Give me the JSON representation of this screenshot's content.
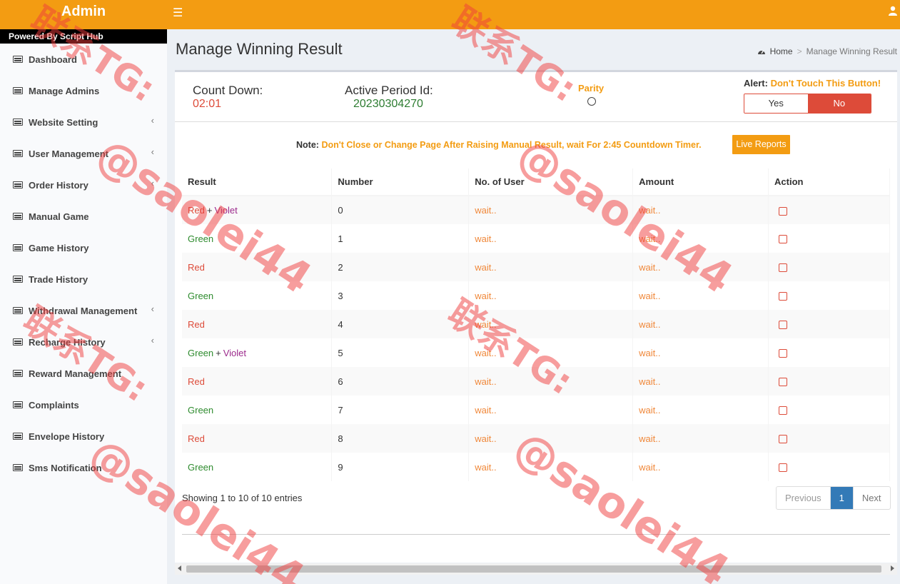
{
  "header": {
    "brand": "Admin",
    "powered_by": "Powered By Script Hub"
  },
  "sidebar": {
    "items": [
      {
        "label": "Dashboard",
        "chevron": ""
      },
      {
        "label": "Manage Admins",
        "chevron": ""
      },
      {
        "label": "Website Setting",
        "chevron": "‹"
      },
      {
        "label": "User Management",
        "chevron": "‹"
      },
      {
        "label": "Order History",
        "chevron": "‹"
      },
      {
        "label": "Manual Game",
        "chevron": ""
      },
      {
        "label": "Game History",
        "chevron": ""
      },
      {
        "label": "Trade History",
        "chevron": ""
      },
      {
        "label": "Withdrawal Management",
        "chevron": "‹"
      },
      {
        "label": "Recharge History",
        "chevron": "‹"
      },
      {
        "label": "Reward Management",
        "chevron": ""
      },
      {
        "label": "Complaints",
        "chevron": ""
      },
      {
        "label": "Envelope History",
        "chevron": ""
      },
      {
        "label": "Sms Notification",
        "chevron": ""
      }
    ]
  },
  "page": {
    "title": "Manage Winning Result",
    "breadcrumb": {
      "home": "Home",
      "sep": ">",
      "current": "Manage Winning Result"
    }
  },
  "info": {
    "countdown_label": "Count Down:",
    "countdown_value": "02:01",
    "period_label": "Active Period Id:",
    "period_value": "20230304270",
    "parity_label": "Parity",
    "alert_key": "Alert:",
    "alert_value": "Don't Touch This Button!",
    "toggle_yes": "Yes",
    "toggle_no": "No"
  },
  "note": {
    "key": "Note:",
    "value": "Don't Close or Change Page After Raising Manual Result, wait For 2:45 Countdown Timer.",
    "live_reports": "Live Reports"
  },
  "table": {
    "headers": [
      "Result",
      "Number",
      "No. of User",
      "Amount",
      "Action"
    ],
    "plus": "+",
    "rows": [
      {
        "result": "Red",
        "extra": "Violet",
        "number": "0",
        "users": "wait..",
        "amount": "wait.."
      },
      {
        "result": "Green",
        "extra": "",
        "number": "1",
        "users": "wait..",
        "amount": "wait.."
      },
      {
        "result": "Red",
        "extra": "",
        "number": "2",
        "users": "wait..",
        "amount": "wait.."
      },
      {
        "result": "Green",
        "extra": "",
        "number": "3",
        "users": "wait..",
        "amount": "wait.."
      },
      {
        "result": "Red",
        "extra": "",
        "number": "4",
        "users": "wait..",
        "amount": "wait.."
      },
      {
        "result": "Green",
        "extra": "Violet",
        "number": "5",
        "users": "wait..",
        "amount": "wait.."
      },
      {
        "result": "Red",
        "extra": "",
        "number": "6",
        "users": "wait..",
        "amount": "wait.."
      },
      {
        "result": "Green",
        "extra": "",
        "number": "7",
        "users": "wait..",
        "amount": "wait.."
      },
      {
        "result": "Red",
        "extra": "",
        "number": "8",
        "users": "wait..",
        "amount": "wait.."
      },
      {
        "result": "Green",
        "extra": "",
        "number": "9",
        "users": "wait..",
        "amount": "wait.."
      }
    ]
  },
  "footer": {
    "showing": "Showing 1 to 10 of 10 entries",
    "previous": "Previous",
    "page": "1",
    "next": "Next"
  },
  "watermark": {
    "line1": "联系TG:",
    "line2": "@saolei44"
  }
}
